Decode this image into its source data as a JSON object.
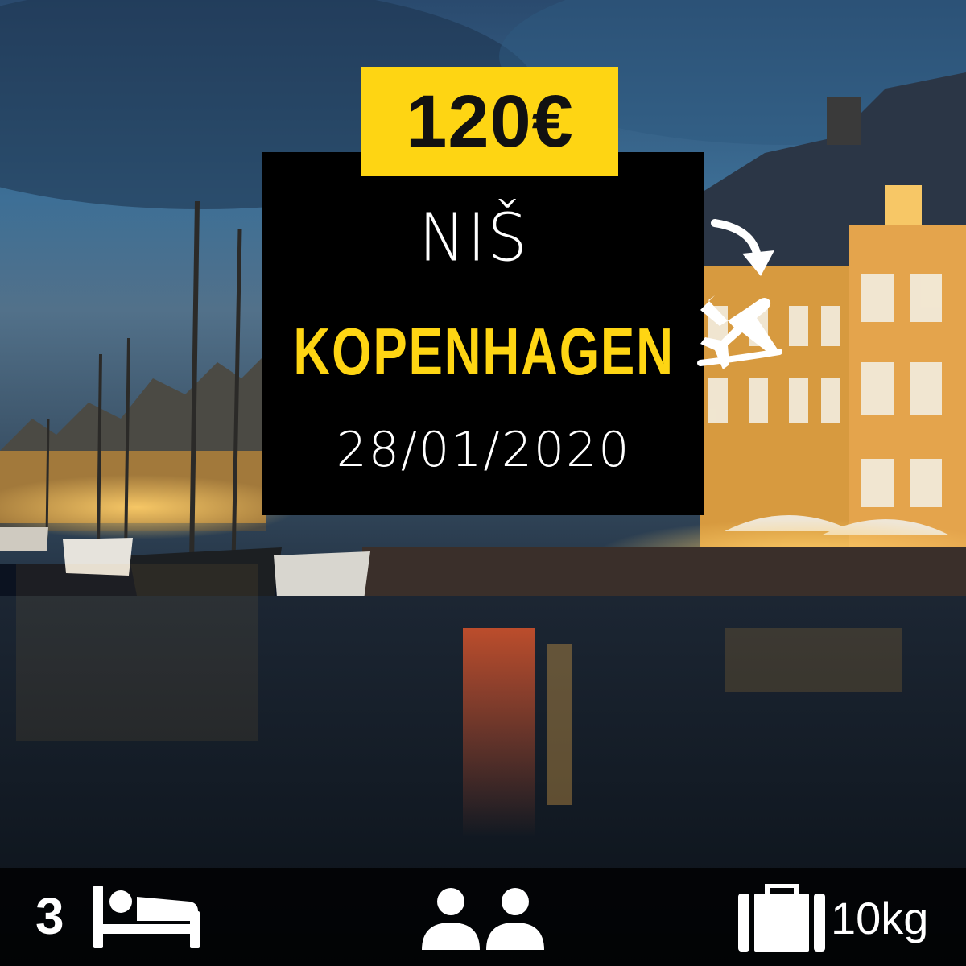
{
  "offer": {
    "price": "120€",
    "origin": "NIŠ",
    "destination": "KOPENHAGEN",
    "date": "28/01/2020"
  },
  "details": {
    "nights": "3",
    "luggage": "10kg"
  },
  "icons": {
    "flight": "airplane-icon",
    "arrow": "curved-arrow-icon",
    "nights": "bed-icon",
    "travelers": "two-people-icon",
    "baggage": "suitcase-icon"
  },
  "colors": {
    "accent": "#fed513",
    "card": "#000000",
    "text": "#ffffff"
  }
}
